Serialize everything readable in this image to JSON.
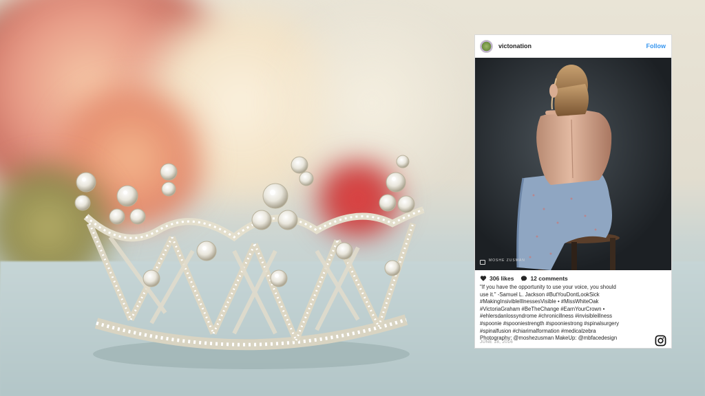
{
  "post": {
    "username": "victonation",
    "follow_label": "Follow",
    "watermark": "MOSHE ZUSMAN",
    "likes": "306 likes",
    "comments": "12 comments",
    "caption_lines": [
      "\"If you have the opportunity to use your voice, you should",
      "use it.\" -Samuel L. Jackson #ButYouDontLookSick",
      "#MakingInsivibleIllnessesVisible • #MissWhiteOak",
      "#VictoriaGraham #BeTheChange #EarnYourCrown •",
      "#ehlersdanlossyndrome #chronicillness #invisibleillness",
      "#spoonie #spooniestrength #spooniestrong #spinalsurgery",
      "#spinalfusion #chiarimalformation #medicalzebra",
      "Photography: @moshezusman MakeUp: @mbfacedesign"
    ],
    "date": "JUNE 18, 2016"
  },
  "icons": {
    "avatar": "avatar-image",
    "heart": "heart-icon",
    "comment": "comment-icon",
    "instagram": "instagram-logo-icon",
    "camera": "camera-icon"
  },
  "colors": {
    "follow": "#3897f0",
    "hashtag": "#3b5998",
    "text": "#262626",
    "date": "#999999"
  }
}
